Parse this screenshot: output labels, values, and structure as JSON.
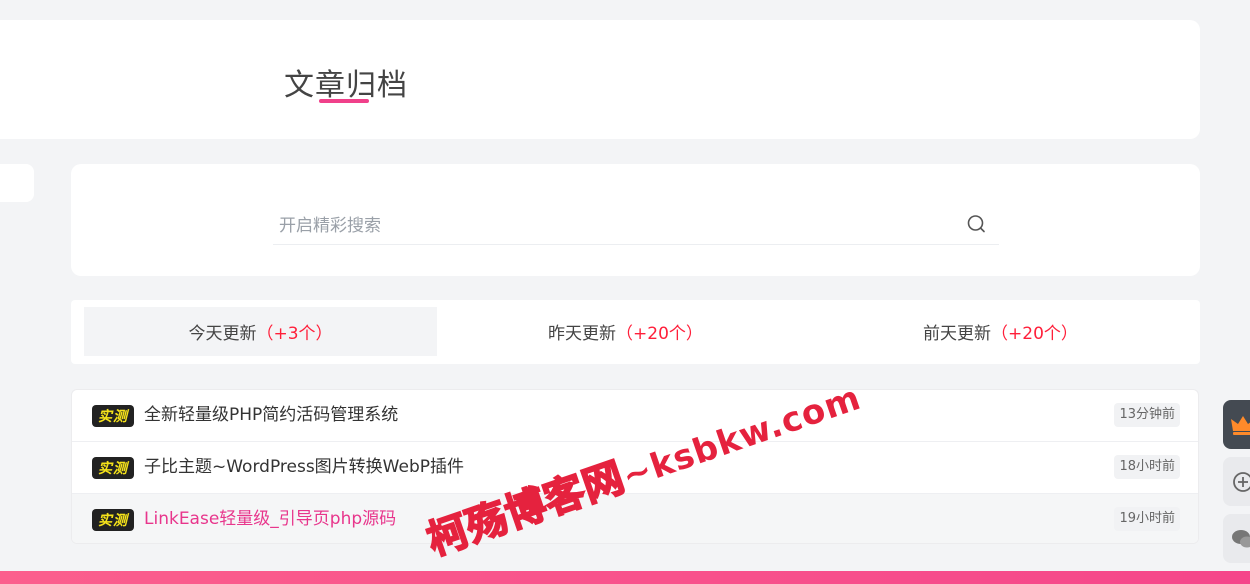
{
  "header": {
    "title": "文章归档"
  },
  "search": {
    "placeholder": "开启精彩搜索"
  },
  "tabs": [
    {
      "label": "今天更新",
      "count": "（+3个）",
      "active": true
    },
    {
      "label": "昨天更新",
      "count": "（+20个）",
      "active": false
    },
    {
      "label": "前天更新",
      "count": "（+20个）",
      "active": false
    }
  ],
  "posts": [
    {
      "badge": "实测",
      "title": "全新轻量级PHP简约活码管理系统",
      "time": "13分钟前"
    },
    {
      "badge": "实测",
      "title": "子比主题~WordPress图片转换WebP插件",
      "time": "18小时前"
    },
    {
      "badge": "实测",
      "title": "LinkEase轻量级_引导页php源码",
      "time": "19小时前"
    }
  ],
  "watermark": {
    "name": "柯殇博客网",
    "url": "~ksbkw.com"
  },
  "floating": [
    {
      "icon": "crown-icon"
    },
    {
      "icon": "plus-circle-icon"
    },
    {
      "icon": "chat-icon"
    }
  ],
  "colors": {
    "accent": "#f0408a",
    "count_red": "#ff1f3a",
    "badge_yellow": "#f5e21a",
    "hover_title": "#e8368c"
  }
}
